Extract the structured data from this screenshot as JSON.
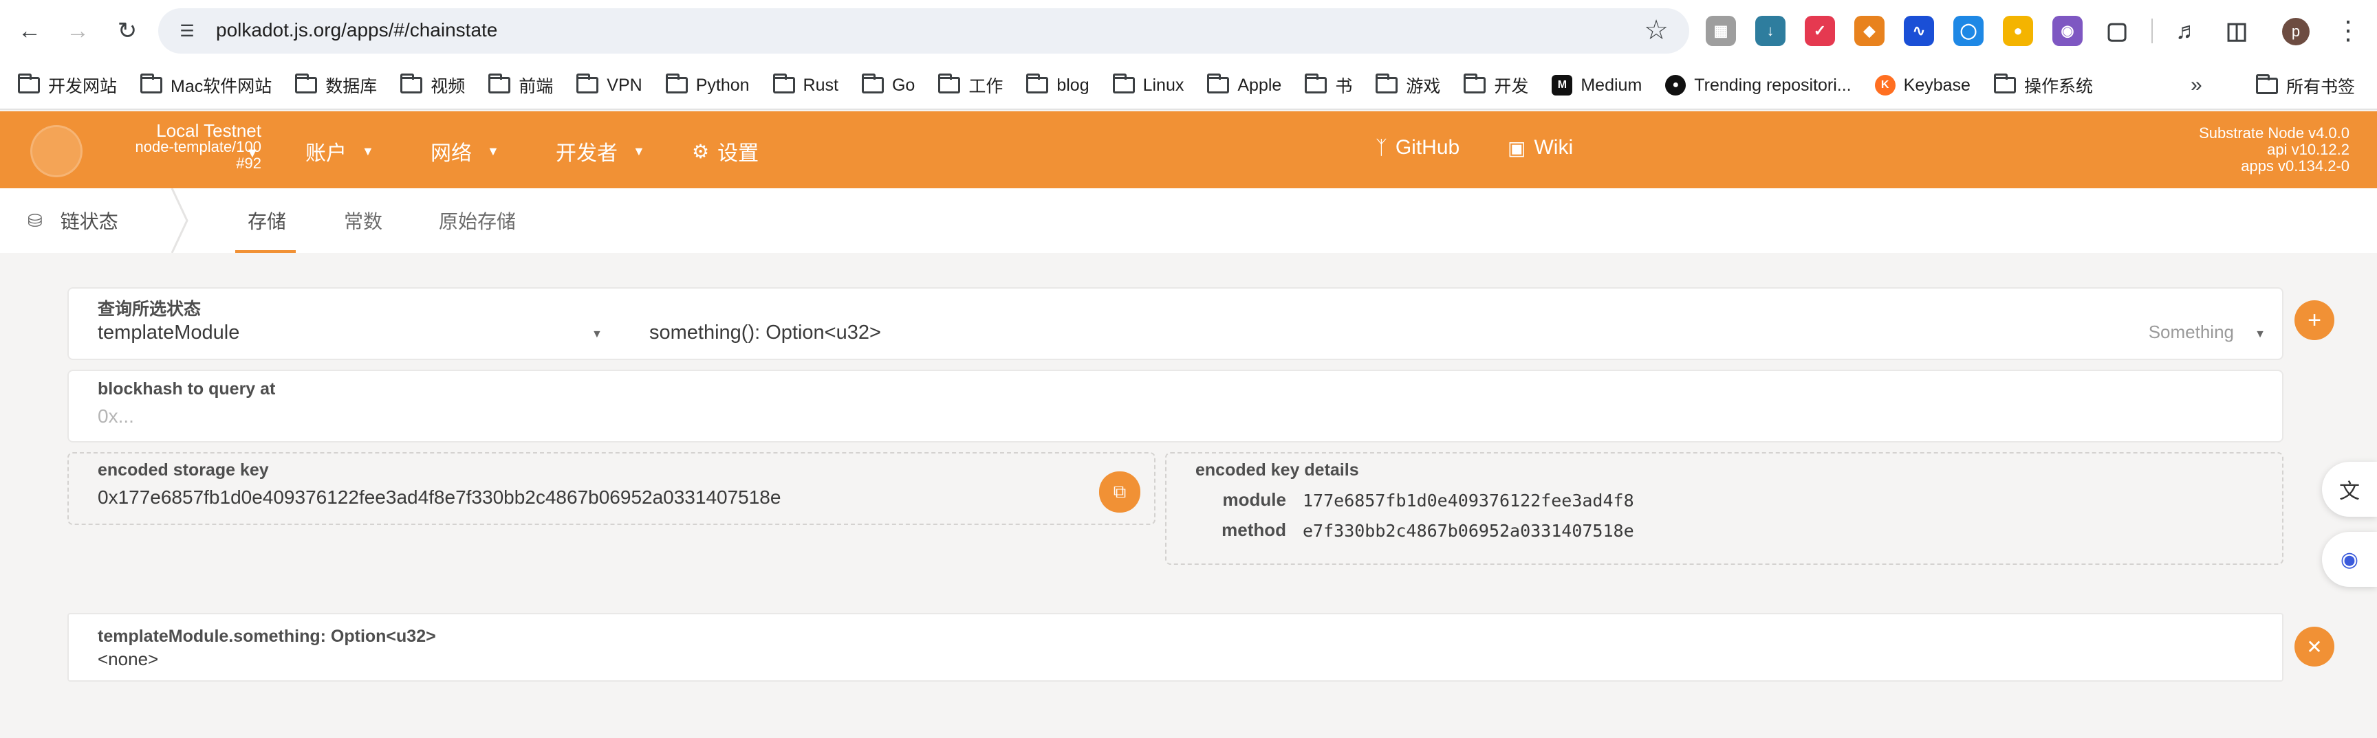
{
  "browser": {
    "url": "polkadot.js.org/apps/#/chainstate",
    "bookmarks": [
      "开发网站",
      "Mac软件网站",
      "数据库",
      "视频",
      "前端",
      "VPN",
      "Python",
      "Rust",
      "Go",
      "工作",
      "blog",
      "Linux",
      "Apple",
      "书",
      "游戏",
      "开发"
    ],
    "bookmark_sites": [
      "Medium",
      "Trending repositori...",
      "Keybase"
    ],
    "bookmark_os": "操作系统",
    "all_bookmarks": "所有书签",
    "profile_initial": "p"
  },
  "header": {
    "network": "Local Testnet",
    "runtime": "node-template/100",
    "block": "#92",
    "menus": [
      "账户",
      "网络",
      "开发者"
    ],
    "settings": "设置",
    "github": "GitHub",
    "wiki": "Wiki",
    "versions": [
      "Substrate Node v4.0.0",
      "api v10.12.2",
      "apps v0.134.2-0"
    ],
    "accent_color": "#f19135"
  },
  "subnav": {
    "section": "链状态",
    "tabs": [
      "存储",
      "常数",
      "原始存储"
    ],
    "active_tab": 0
  },
  "query": {
    "label": "查询所选状态",
    "module": "templateModule",
    "method": "something(): Option<u32>",
    "method_hint": "Something"
  },
  "blockhash": {
    "label": "blockhash to query at",
    "placeholder": "0x..."
  },
  "storage_key": {
    "label": "encoded storage key",
    "value": "0x177e6857fb1d0e409376122fee3ad4f8e7f330bb2c4867b06952a0331407518e"
  },
  "key_details": {
    "label": "encoded key details",
    "module_label": "module",
    "module_value": "177e6857fb1d0e409376122fee3ad4f8",
    "method_label": "method",
    "method_value": "e7f330bb2c4867b06952a0331407518e"
  },
  "result": {
    "title": "templateModule.something: Option<u32>",
    "value": "<none>"
  }
}
